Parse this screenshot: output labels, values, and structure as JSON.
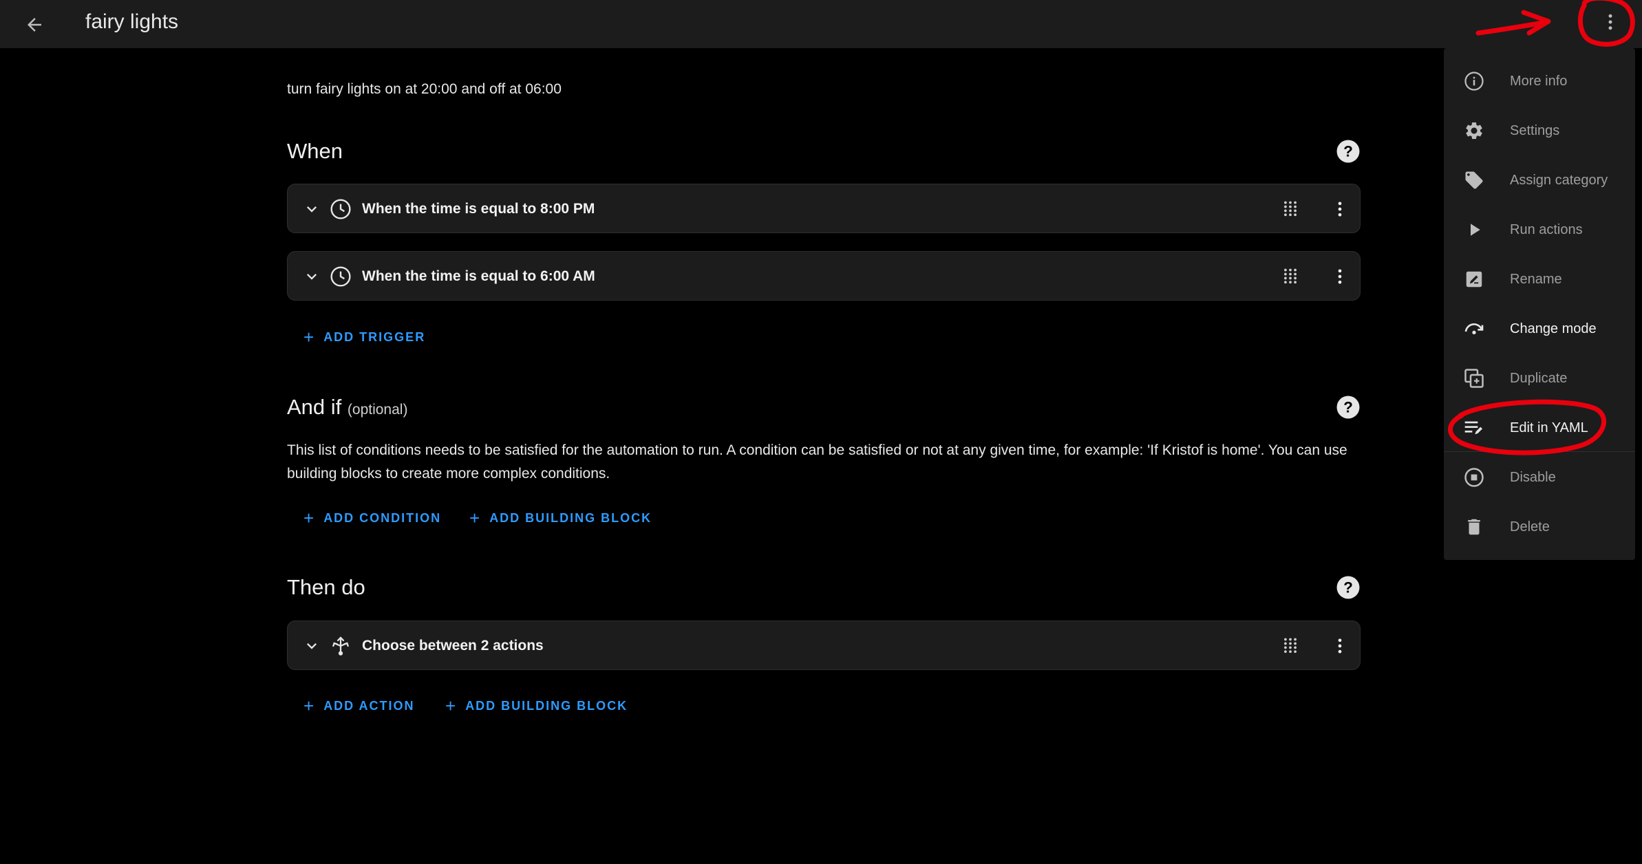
{
  "header": {
    "back_icon": "arrow-left-icon",
    "title": "fairy lights",
    "overflow_icon": "dots-vertical-icon"
  },
  "description": "turn fairy lights on at 20:00 and off at 06:00",
  "sections": {
    "when": {
      "title": "When",
      "triggers": [
        {
          "label": "When the time is equal to 8:00 PM",
          "icon": "clock-icon"
        },
        {
          "label": "When the time is equal to 6:00 AM",
          "icon": "clock-icon"
        }
      ],
      "add_trigger": "ADD TRIGGER"
    },
    "and_if": {
      "title": "And if",
      "optional": "(optional)",
      "text": "This list of conditions needs to be satisfied for the automation to run. A condition can be satisfied or not at any given time, for example: 'If Kristof is home'. You can use building blocks to create more complex conditions.",
      "add_condition": "ADD CONDITION",
      "add_building_block": "ADD BUILDING BLOCK"
    },
    "then_do": {
      "title": "Then do",
      "actions": [
        {
          "label": "Choose between 2 actions",
          "icon": "choose-icon"
        }
      ],
      "add_action": "ADD ACTION",
      "add_building_block": "ADD BUILDING BLOCK"
    }
  },
  "menu": {
    "items": [
      {
        "label": "More info",
        "icon": "info-icon"
      },
      {
        "label": "Settings",
        "icon": "gear-icon"
      },
      {
        "label": "Assign category",
        "icon": "tag-icon"
      },
      {
        "label": "Run actions",
        "icon": "play-icon"
      },
      {
        "label": "Rename",
        "icon": "rename-icon"
      },
      {
        "label": "Change mode",
        "icon": "change-mode-icon"
      },
      {
        "label": "Duplicate",
        "icon": "duplicate-icon"
      },
      {
        "label": "Edit in YAML",
        "icon": "edit-yaml-icon"
      },
      {
        "label": "Disable",
        "icon": "stop-circle-icon"
      },
      {
        "label": "Delete",
        "icon": "trash-icon"
      }
    ]
  },
  "colors": {
    "background": "#000000",
    "surface": "#1c1c1c",
    "accent": "#2e9bff",
    "annotation": "#e8000d"
  }
}
